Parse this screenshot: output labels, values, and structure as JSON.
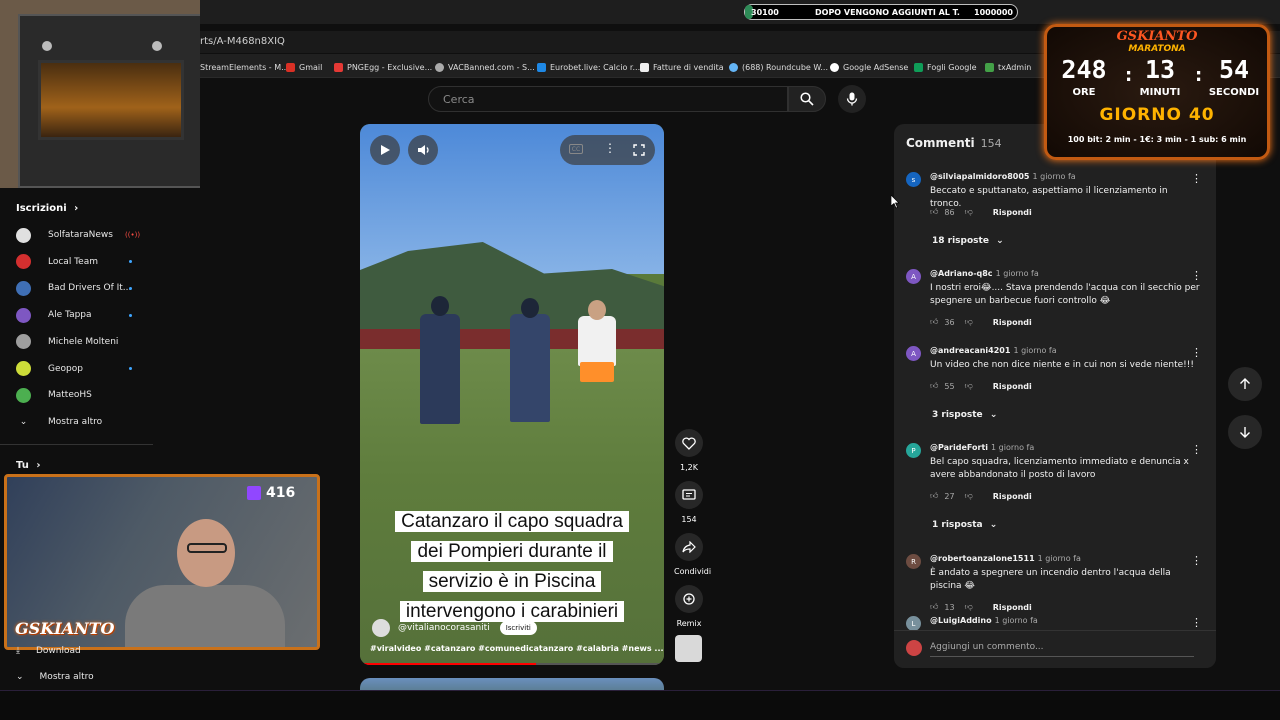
{
  "browser": {
    "url": "rts/A-M468n8XIQ",
    "bookmarks": [
      "StreamElements - M...",
      "Gmail",
      "PNGEgg - Exclusive...",
      "VACBanned.com - S...",
      "Eurobet.live: Calcio r...",
      "Fatture di vendita",
      "(688) Roundcube W...",
      "Google AdSense",
      "Fogli Google",
      "txAdmin"
    ]
  },
  "goal_bar": {
    "min": "30100",
    "text": "DOPO VENGONO AGGIUNTI AL T.",
    "max": "1000000",
    "color": "#2e8b57"
  },
  "search": {
    "placeholder": "Cerca"
  },
  "sidebar": {
    "subscriptions_title": "Iscrizioni",
    "items": [
      {
        "label": "SolfataraNews",
        "badge": "live",
        "avatar_color": "#e0e0e0"
      },
      {
        "label": "Local Team",
        "badge": "dot",
        "avatar_color": "#d32f2f"
      },
      {
        "label": "Bad Drivers Of It...",
        "badge": "dot",
        "avatar_color": "#3f6fb5"
      },
      {
        "label": "Ale Tappa",
        "badge": "dot",
        "avatar_color": "#7e57c2"
      },
      {
        "label": "Michele Molteni",
        "badge": "",
        "avatar_color": "#9e9e9e"
      },
      {
        "label": "Geopop",
        "badge": "dot",
        "avatar_color": "#cddc39"
      },
      {
        "label": "MatteoHS",
        "badge": "",
        "avatar_color": "#4caf50"
      }
    ],
    "show_more": "Mostra altro",
    "you_title": "Tu",
    "download": "Download",
    "show_more_2": "Mostra altro"
  },
  "video": {
    "caption_lines": [
      "Catanzaro il capo squadra",
      "dei Pompieri durante il",
      "servizio è in Piscina",
      "intervengono i carabinieri"
    ],
    "channel": "@vitalianocorasaniti",
    "subscribe_label": "Iscriviti",
    "hashtags": "#viralvideo #catanzaro #comunedicatanzaro #calabria #news ..."
  },
  "actions": {
    "likes": "1,2K",
    "comments": "154",
    "share": "Condividi",
    "remix": "Remix"
  },
  "comments_panel": {
    "title": "Commenti",
    "count": "154",
    "items": [
      {
        "user": "@silviapalmidoro8005",
        "time": "1 giorno fa",
        "text": "Beccato e sputtanato, aspettiamo il licenziamento in tronco.",
        "likes": "86",
        "reply": "Rispondi",
        "initial": "s",
        "color": "#1565c0",
        "replies": "18 risposte"
      },
      {
        "user": "@Adriano-q8c",
        "time": "1 giorno fa",
        "text": "I nostri eroi😂.... Stava prendendo l'acqua con il secchio per spegnere un barbecue fuori controllo 😂",
        "likes": "36",
        "reply": "Rispondi",
        "initial": "A",
        "color": "#7e57c2",
        "replies": ""
      },
      {
        "user": "@andreacani4201",
        "time": "1 giorno fa",
        "text": "Un video che non dice niente e in cui non si vede niente!!!",
        "likes": "55",
        "reply": "Rispondi",
        "initial": "A",
        "color": "#7e57c2",
        "replies": "3 risposte"
      },
      {
        "user": "@ParideForti",
        "time": "1 giorno fa",
        "text": "Bel capo squadra, licenziamento immediato e denuncia x avere abbandonato il posto di lavoro",
        "likes": "27",
        "reply": "Rispondi",
        "initial": "P",
        "color": "#26a69a",
        "replies": "1 risposta"
      },
      {
        "user": "@robertoanzalone1511",
        "time": "1 giorno fa",
        "text": "È andato a spegnere un  incendio dentro l'acqua della piscina 😂",
        "likes": "13",
        "reply": "Rispondi",
        "initial": "R",
        "color": "#6d4c41",
        "replies": ""
      },
      {
        "user": "@LuigiAddino",
        "time": "1 giorno fa",
        "text": "",
        "likes": "",
        "reply": "",
        "initial": "L",
        "color": "#78909c",
        "replies": ""
      }
    ],
    "add_placeholder": "Aggiungi un commento..."
  },
  "timer": {
    "brand": "GSKIANTO",
    "subtitle": "MARATONA",
    "hours": "248",
    "hours_label": "ORE",
    "minutes": "13",
    "minutes_label": "MINUTI",
    "seconds": "54",
    "seconds_label": "SECONDI",
    "day": "GIORNO 40",
    "rules": "100 bit: 2 min - 1€: 3 min - 1 sub: 6 min"
  },
  "webcam": {
    "viewers": "416",
    "logo": "GSKIANTO"
  }
}
